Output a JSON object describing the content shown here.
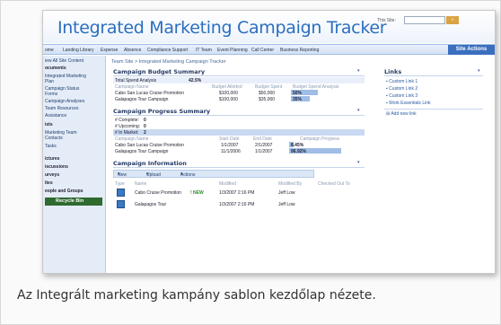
{
  "header": {
    "title": "Integrated Marketing Campaign Tracker",
    "this_site_label": "This Site:"
  },
  "tabs": [
    "ome",
    "Landing Library",
    "Expense",
    "Absence",
    "Compliance Support",
    "IT Team",
    "Event Planning",
    "Call Center",
    "Business Reporting"
  ],
  "site_actions": "Site Actions",
  "left_nav": {
    "items": [
      {
        "label": "iew All Site Content",
        "heading": false
      },
      {
        "label": "ocuments",
        "heading": true
      },
      {
        "label": "Integrated Marketing",
        "heading": false
      },
      {
        "label": "Plan",
        "heading": false
      },
      {
        "label": "Campaign Status",
        "heading": false
      },
      {
        "label": "Forms",
        "heading": false
      },
      {
        "label": "Campaign Analyses",
        "heading": false
      },
      {
        "label": "Team Resources",
        "heading": false
      },
      {
        "label": "Assistance",
        "heading": false
      },
      {
        "label": "ists",
        "heading": true
      },
      {
        "label": "Marketing Team",
        "heading": false
      },
      {
        "label": "Contacts",
        "heading": false
      },
      {
        "label": "Tasks",
        "heading": false
      },
      {
        "label": "ictures",
        "heading": true
      },
      {
        "label": "iscussions",
        "heading": true
      },
      {
        "label": "urveys",
        "heading": true
      },
      {
        "label": "ites",
        "heading": true
      },
      {
        "label": "eople and Groups",
        "heading": true
      }
    ],
    "recycle_bin": "Recycle Bin"
  },
  "breadcrumb": "Team Site > Integrated Marketing Campaign Tracker",
  "budget": {
    "title": "Campaign Budget Summary",
    "total_label": "Total Spend Analysis",
    "total_value": "42.5%",
    "columns": [
      "Campaign Name",
      "Budget Allotted",
      "Budget Spent",
      "Budget Spend Analysis"
    ],
    "rows": [
      {
        "name": "Cabo San Lucas Cruise Promotion",
        "allotted": "$100,000",
        "spent": "$50,000",
        "analysis": "50%",
        "pct": 0.5
      },
      {
        "name": "Galapagos Tour Campaign",
        "allotted": "$100,000",
        "spent": "$35,000",
        "analysis": "35%",
        "pct": 0.35
      }
    ]
  },
  "progress": {
    "title": "Campaign Progress Summary",
    "counts": [
      {
        "label": "# Complete:",
        "value": "0"
      },
      {
        "label": "# Upcoming:",
        "value": "0"
      },
      {
        "label": "# In Market:",
        "value": "2"
      }
    ],
    "columns": [
      "Campaign Name",
      "Start Date",
      "End Date",
      "Campaign Progress"
    ],
    "rows": [
      {
        "name": "Cabo San Lucas Cruise Promotion",
        "start": "1/1/2007",
        "end": "2/1/2007",
        "progress": "8.45%",
        "pct": 0.0845
      },
      {
        "name": "Galapagos Tour Campaign",
        "start": "11/1/2006",
        "end": "1/1/2007",
        "progress": "96.92%",
        "pct": 0.9692
      }
    ]
  },
  "info": {
    "title": "Campaign Information",
    "toolbar": {
      "new": "New",
      "upload": "Upload",
      "actions": "Actions"
    },
    "columns": [
      "Type",
      "Name",
      "Modified",
      "Modified By",
      "Checked Out To"
    ],
    "rows": [
      {
        "name": "Cabo Cruise Promotion",
        "new": "! NEW",
        "modified": "1/3/2007 2:16 PM",
        "by": "Jeff Low"
      },
      {
        "name": "Galapagos Tour",
        "new": "",
        "modified": "1/3/2007 2:16 PM",
        "by": "Jeff Low"
      }
    ]
  },
  "links": {
    "title": "Links",
    "items": [
      "Custom Link 1",
      "Custom Link 2",
      "Custom Link 3",
      "Work Essentials Link"
    ],
    "add_new": "Add new link"
  },
  "caption": "Az Integrált marketing kampány sablon kezdőlap nézete.",
  "colors": {
    "accent": "#2a6fbf",
    "nav_bg": "#e4ecf8",
    "recycle": "#2f6a2f"
  }
}
